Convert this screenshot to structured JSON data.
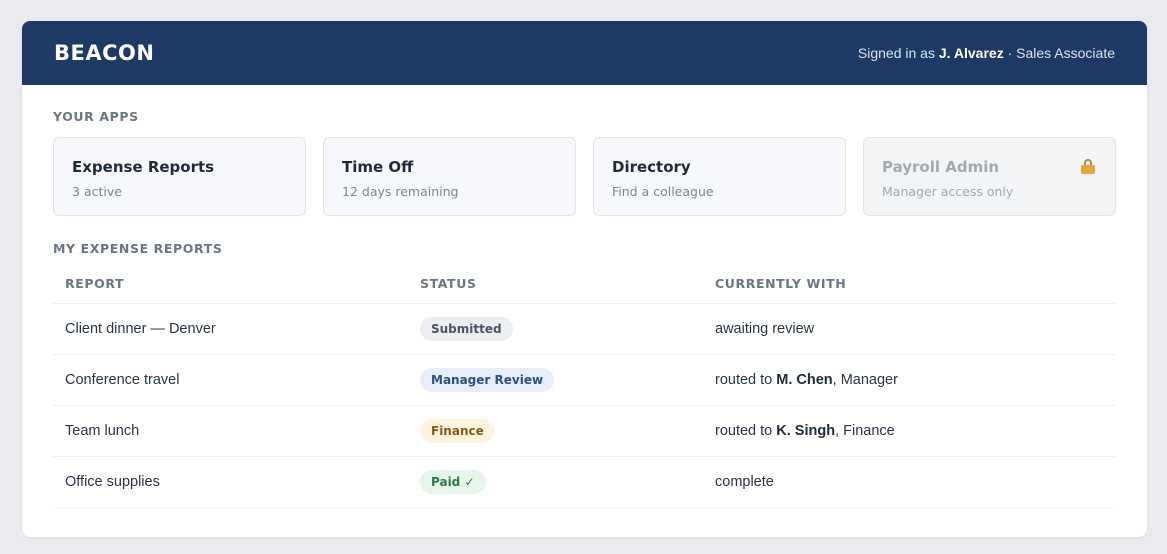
{
  "header": {
    "brand": "BEACON",
    "signed_prefix": "Signed in as ",
    "user_name": "J. Alvarez",
    "separator": " · ",
    "user_role": "Sales Associate"
  },
  "apps_section": {
    "title": "YOUR APPS",
    "apps": [
      {
        "name": "Expense Reports",
        "sub": "3 active"
      },
      {
        "name": "Time Off",
        "sub": "12 days remaining"
      },
      {
        "name": "Directory",
        "sub": "Find a colleague"
      },
      {
        "name": "Payroll Admin",
        "sub": "Manager access only",
        "icon": "lock-icon"
      }
    ]
  },
  "reports_section": {
    "title": "MY EXPENSE REPORTS",
    "columns": [
      "REPORT",
      "STATUS",
      "CURRENTLY WITH"
    ],
    "rows": [
      {
        "report": "Client dinner — Denver",
        "status": "Submitted",
        "status_bg": "#eceef2",
        "status_color": "#4a5465",
        "with_prefix": "awaiting review",
        "with_name": "",
        "with_suffix": ""
      },
      {
        "report": "Conference travel",
        "status": "Manager Review",
        "status_bg": "#e7eef9",
        "status_color": "#2c4f86",
        "with_prefix": "routed to ",
        "with_name": "M. Chen",
        "with_suffix": ", Manager"
      },
      {
        "report": "Team lunch",
        "status": "Finance",
        "status_bg": "#fdf3df",
        "status_color": "#8a5a12",
        "with_prefix": "routed to ",
        "with_name": "K. Singh",
        "with_suffix": ", Finance"
      },
      {
        "report": "Office supplies",
        "status": "Paid ✓",
        "status_bg": "#e5f5ea",
        "status_color": "#2d7a47",
        "with_prefix": "complete",
        "with_name": "",
        "with_suffix": ""
      }
    ]
  },
  "colors": {
    "header_bg": "#1c3a63",
    "page_bg": "#e9ebee"
  }
}
